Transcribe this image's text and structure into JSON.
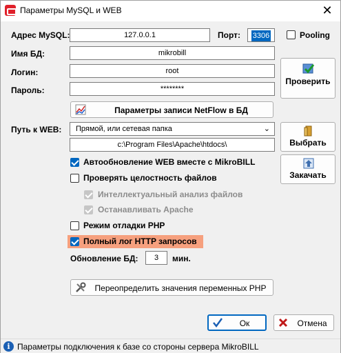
{
  "window": {
    "title": "Параметры MySQL и WEB",
    "close_glyph": "✕"
  },
  "db": {
    "host_label": "Адрес MySQL:",
    "host_value": "127.0.0.1",
    "port_label": "Порт:",
    "port_value": "3306",
    "pooling_label": "Pooling",
    "pooling_checked": false,
    "dbname_label": "Имя БД:",
    "dbname_value": "mikrobill",
    "login_label": "Логин:",
    "login_value": "root",
    "password_label": "Пароль:",
    "password_value": "********",
    "check_button": "Проверить"
  },
  "netflow_button": "Параметры записи NetFlow в БД",
  "web": {
    "path_label": "Путь к WEB:",
    "mode_selected": "Прямой, или сетевая папка",
    "path_value": "c:\\Program Files\\Apache\\htdocs\\",
    "choose_button": "Выбрать",
    "upload_button": "Закачать"
  },
  "options": {
    "auto_update_web": {
      "label": "Автообновление WEB вместе с MikroBILL",
      "checked": true
    },
    "check_integrity": {
      "label": "Проверять целостность файлов",
      "checked": false
    },
    "intelligent_analysis": {
      "label": "Интеллектуальный анализ файлов",
      "checked": true,
      "disabled": true
    },
    "stop_apache": {
      "label": "Останавливать Apache",
      "checked": true,
      "disabled": true
    },
    "php_debug": {
      "label": "Режим отладки PHP",
      "checked": false
    },
    "full_http_log": {
      "label": "Полный лог HTTP запросов",
      "checked": true
    }
  },
  "db_update": {
    "label": "Обновление БД:",
    "value": "3",
    "unit": "мин."
  },
  "php_vars_button": "Переопределить значения переменных PHP",
  "footer": {
    "ok_button": "Ок",
    "cancel_button": "Отмена"
  },
  "status": {
    "text": "Параметры подключения к базе со стороны сервера MikroBILL"
  },
  "colors": {
    "accent": "#0067c0",
    "highlight": "#f6a07e"
  }
}
